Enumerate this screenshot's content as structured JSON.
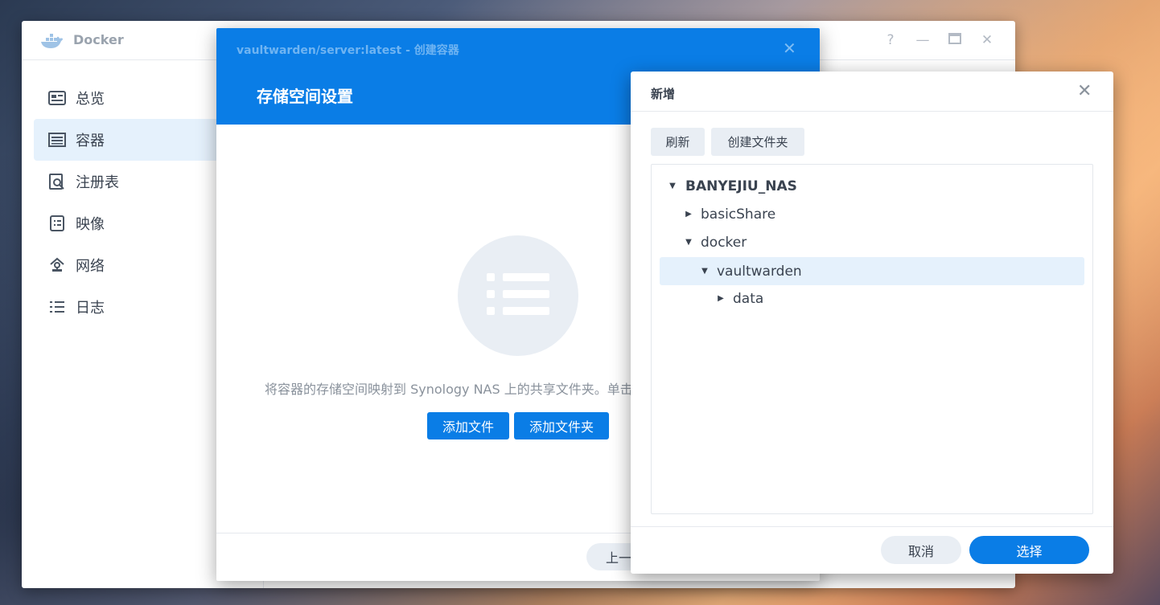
{
  "docker": {
    "app_title": "Docker",
    "controls": {
      "help": "?",
      "minimize": "—",
      "maximize": "□",
      "close": "✕"
    },
    "sidebar": [
      {
        "label": "总览",
        "icon": "overview-icon"
      },
      {
        "label": "容器",
        "icon": "container-icon",
        "active": true
      },
      {
        "label": "注册表",
        "icon": "registry-icon"
      },
      {
        "label": "映像",
        "icon": "image-icon"
      },
      {
        "label": "网络",
        "icon": "network-icon"
      },
      {
        "label": "日志",
        "icon": "log-icon"
      }
    ]
  },
  "wizard": {
    "subtitle": "vaultwarden/server:latest - 创建容器",
    "close": "✕",
    "title": "存储空间设置",
    "description": "将容器的存储空间映射到 Synology NAS 上的共享文件夹。单击",
    "add_file": "添加文件",
    "add_folder": "添加文件夹",
    "prev": "上一步"
  },
  "picker": {
    "title": "新增",
    "close": "✕",
    "refresh": "刷新",
    "create_folder": "创建文件夹",
    "tree": [
      {
        "label": "BANYEJIU_NAS",
        "expanded": true,
        "level": 0
      },
      {
        "label": "basicShare",
        "expanded": false,
        "level": 1
      },
      {
        "label": "docker",
        "expanded": true,
        "level": 1
      },
      {
        "label": "vaultwarden",
        "expanded": true,
        "level": 2,
        "selected": true
      },
      {
        "label": "data",
        "expanded": false,
        "level": 3
      }
    ],
    "cancel": "取消",
    "select": "选择"
  },
  "colors": {
    "accent": "#0a7de6",
    "selected": "#e5f1fc",
    "text": "#3a4350"
  }
}
